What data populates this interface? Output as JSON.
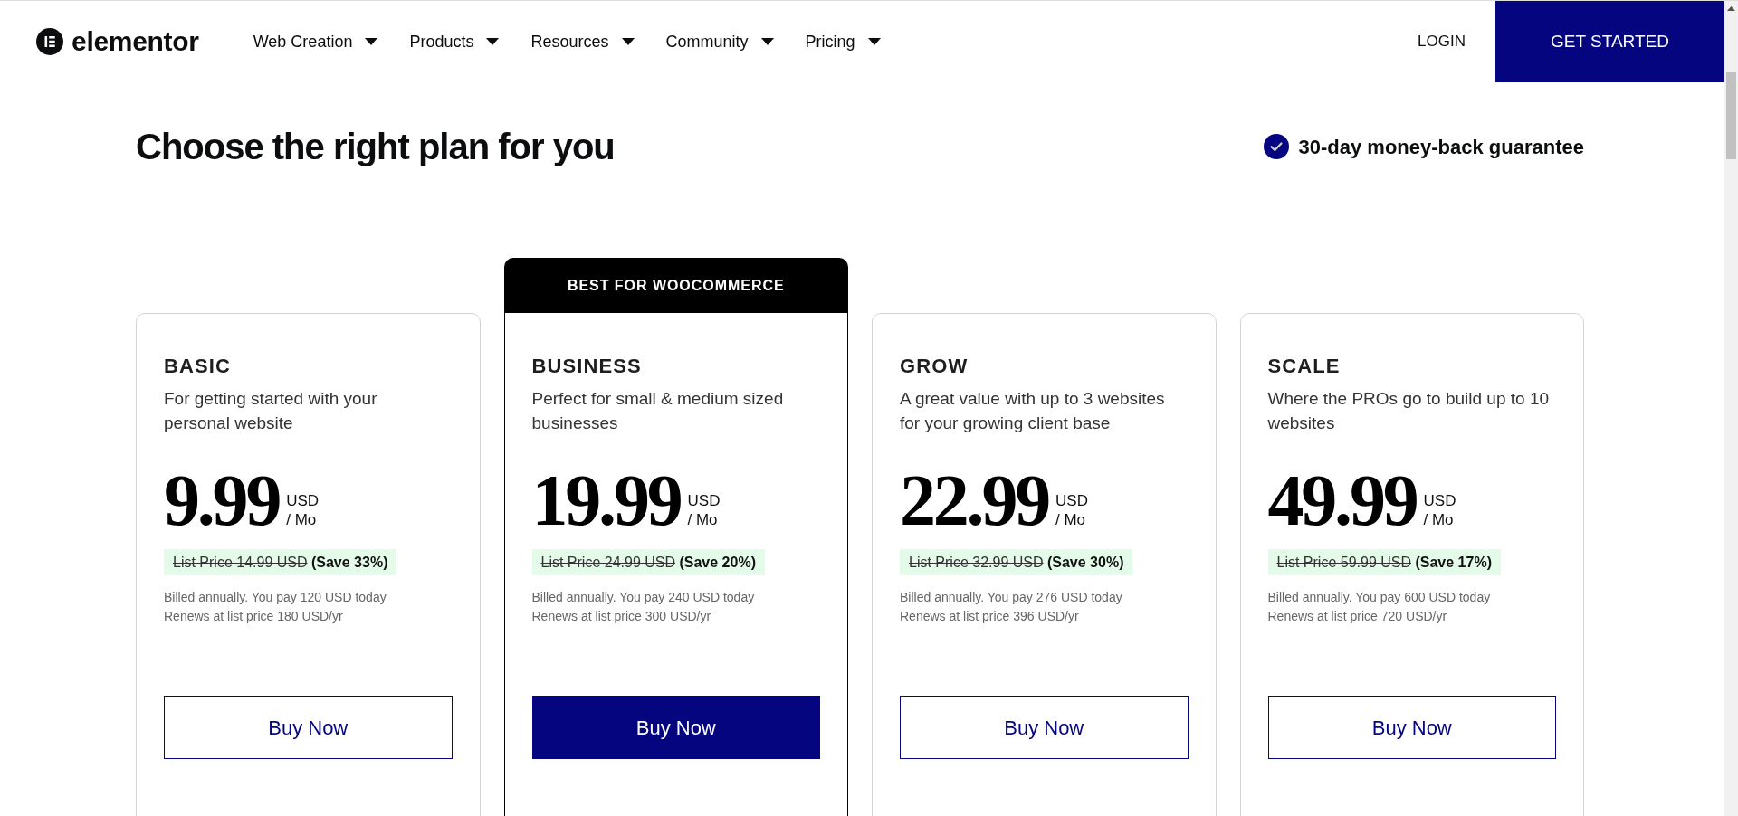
{
  "header": {
    "logo": "elementor",
    "nav": [
      {
        "label": "Web Creation"
      },
      {
        "label": "Products"
      },
      {
        "label": "Resources"
      },
      {
        "label": "Community"
      },
      {
        "label": "Pricing"
      }
    ],
    "login": "LOGIN",
    "cta": "GET STARTED"
  },
  "intro": {
    "title": "Choose the right plan for you",
    "guarantee": "30-day money-back guarantee"
  },
  "plans": [
    {
      "name": "BASIC",
      "featured": false,
      "description": "For getting started with your personal website",
      "price": "9.99",
      "currency": "USD",
      "period": "/ Mo",
      "list_price": "List Price 14.99 USD",
      "saving": "(Save 33%)",
      "billing": "Billed annually. You pay 120 USD today",
      "renewal": "Renews at list price 180 USD/yr",
      "button": "Buy Now"
    },
    {
      "badge": "BEST FOR WOOCOMMERCE",
      "name": "BUSINESS",
      "featured": true,
      "description": "Perfect for small & medium sized businesses",
      "price": "19.99",
      "currency": "USD",
      "period": "/ Mo",
      "list_price": "List Price 24.99 USD",
      "saving": "(Save 20%)",
      "billing": "Billed annually. You pay 240 USD today",
      "renewal": "Renews at list price 300 USD/yr",
      "button": "Buy Now"
    },
    {
      "name": "GROW",
      "featured": false,
      "description": "A great value with up to 3 websites for your growing client base",
      "price": "22.99",
      "currency": "USD",
      "period": "/ Mo",
      "list_price": "List Price 32.99 USD",
      "saving": "(Save 30%)",
      "billing": "Billed annually. You pay 276 USD today",
      "renewal": "Renews at list price 396 USD/yr",
      "button": "Buy Now"
    },
    {
      "name": "SCALE",
      "featured": false,
      "description": "Where the PROs go to build up to 10 websites",
      "price": "49.99",
      "currency": "USD",
      "period": "/ Mo",
      "list_price": "List Price 59.99 USD",
      "saving": "(Save 17%)",
      "billing": "Billed annually. You pay 600 USD today",
      "renewal": "Renews at list price 720 USD/yr",
      "button": "Buy Now"
    }
  ]
}
